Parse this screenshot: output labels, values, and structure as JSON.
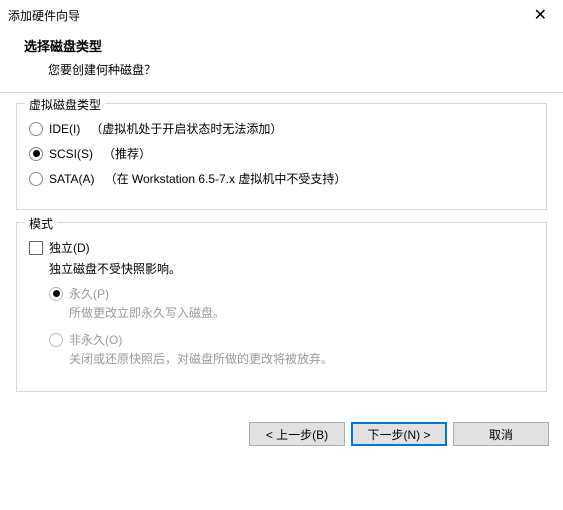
{
  "titlebar": {
    "title": "添加硬件向导"
  },
  "header": {
    "title": "选择磁盘类型",
    "subtitle": "您要创建何种磁盘？"
  },
  "diskType": {
    "legend": "虚拟磁盘类型",
    "options": [
      {
        "label": "IDE(I)",
        "hint": "（虚拟机处于开启状态时无法添加）",
        "checked": false
      },
      {
        "label": "SCSI(S)",
        "hint": "（推荐）",
        "checked": true
      },
      {
        "label": "SATA(A)",
        "hint": "（在 Workstation 6.5-7.x 虚拟机中不受支持）",
        "checked": false
      }
    ]
  },
  "mode": {
    "legend": "模式",
    "independent": {
      "label": "独立(D)",
      "checked": false,
      "description": "独立磁盘不受快照影响。"
    },
    "permanent": {
      "label": "永久(P)",
      "description": "所做更改立即永久写入磁盘。",
      "checked": true,
      "enabled": false
    },
    "nonpermanent": {
      "label": "非永久(O)",
      "description": "关闭或还原快照后，对磁盘所做的更改将被放弃。",
      "checked": false,
      "enabled": false
    }
  },
  "buttons": {
    "back": "< 上一步(B)",
    "next": "下一步(N) >",
    "cancel": "取消"
  }
}
